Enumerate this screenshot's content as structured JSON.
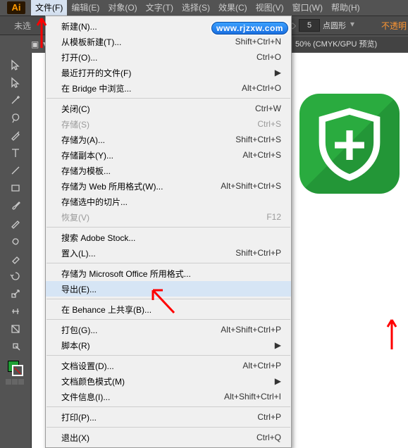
{
  "app": {
    "logo": "Ai"
  },
  "menubar": {
    "items": [
      {
        "label": "文件(F)",
        "active": true
      },
      {
        "label": "编辑(E)"
      },
      {
        "label": "对象(O)"
      },
      {
        "label": "文字(T)"
      },
      {
        "label": "选择(S)"
      },
      {
        "label": "效果(C)"
      },
      {
        "label": "视图(V)"
      },
      {
        "label": "窗口(W)"
      },
      {
        "label": "帮助(H)"
      }
    ]
  },
  "controlbar": {
    "unselected": "未选",
    "stroke_value": "5",
    "stroke_label": "点圆形",
    "opacity": "不透明"
  },
  "watermark": "www.rjzxw.com",
  "tabctx": "50% (CMYK/GPU 预览)",
  "pill": "▣ ▼",
  "dropdown": {
    "items": [
      {
        "label": "新建(N)...",
        "shortcut": "Ctrl+N"
      },
      {
        "label": "从模板新建(T)...",
        "shortcut": "Shift+Ctrl+N"
      },
      {
        "label": "打开(O)...",
        "shortcut": "Ctrl+O"
      },
      {
        "label": "最近打开的文件(F)",
        "sub": true
      },
      {
        "label": "在 Bridge 中浏览...",
        "shortcut": "Alt+Ctrl+O"
      },
      {
        "sep": true
      },
      {
        "label": "关闭(C)",
        "shortcut": "Ctrl+W"
      },
      {
        "label": "存储(S)",
        "shortcut": "Ctrl+S",
        "disabled": true
      },
      {
        "label": "存储为(A)...",
        "shortcut": "Shift+Ctrl+S"
      },
      {
        "label": "存储副本(Y)...",
        "shortcut": "Alt+Ctrl+S"
      },
      {
        "label": "存储为模板..."
      },
      {
        "label": "存储为 Web 所用格式(W)...",
        "shortcut": "Alt+Shift+Ctrl+S"
      },
      {
        "label": "存储选中的切片..."
      },
      {
        "label": "恢复(V)",
        "shortcut": "F12",
        "disabled": true
      },
      {
        "sep": true
      },
      {
        "label": "搜索 Adobe Stock..."
      },
      {
        "label": "置入(L)...",
        "shortcut": "Shift+Ctrl+P"
      },
      {
        "sep": true
      },
      {
        "label": "存储为 Microsoft Office 所用格式..."
      },
      {
        "label": "导出(E)...",
        "hl": true
      },
      {
        "sep": true
      },
      {
        "label": "在 Behance 上共享(B)..."
      },
      {
        "sep": true
      },
      {
        "label": "打包(G)...",
        "shortcut": "Alt+Shift+Ctrl+P"
      },
      {
        "label": "脚本(R)",
        "sub": true
      },
      {
        "sep": true
      },
      {
        "label": "文档设置(D)...",
        "shortcut": "Alt+Ctrl+P"
      },
      {
        "label": "文档颜色模式(M)",
        "sub": true
      },
      {
        "label": "文件信息(I)...",
        "shortcut": "Alt+Shift+Ctrl+I"
      },
      {
        "sep": true
      },
      {
        "label": "打印(P)...",
        "shortcut": "Ctrl+P"
      },
      {
        "sep": true
      },
      {
        "label": "退出(X)",
        "shortcut": "Ctrl+Q"
      }
    ]
  },
  "tools": [
    "selection",
    "direct-selection",
    "wand",
    "lasso",
    "pen",
    "type",
    "line",
    "rectangle",
    "brush",
    "pencil",
    "blob",
    "eraser",
    "rotate",
    "scale",
    "width",
    "free-transform",
    "shape-builder",
    "perspective",
    "mesh",
    "gradient",
    "eyedropper",
    "blend",
    "symbol",
    "graph",
    "artboard",
    "slice"
  ]
}
